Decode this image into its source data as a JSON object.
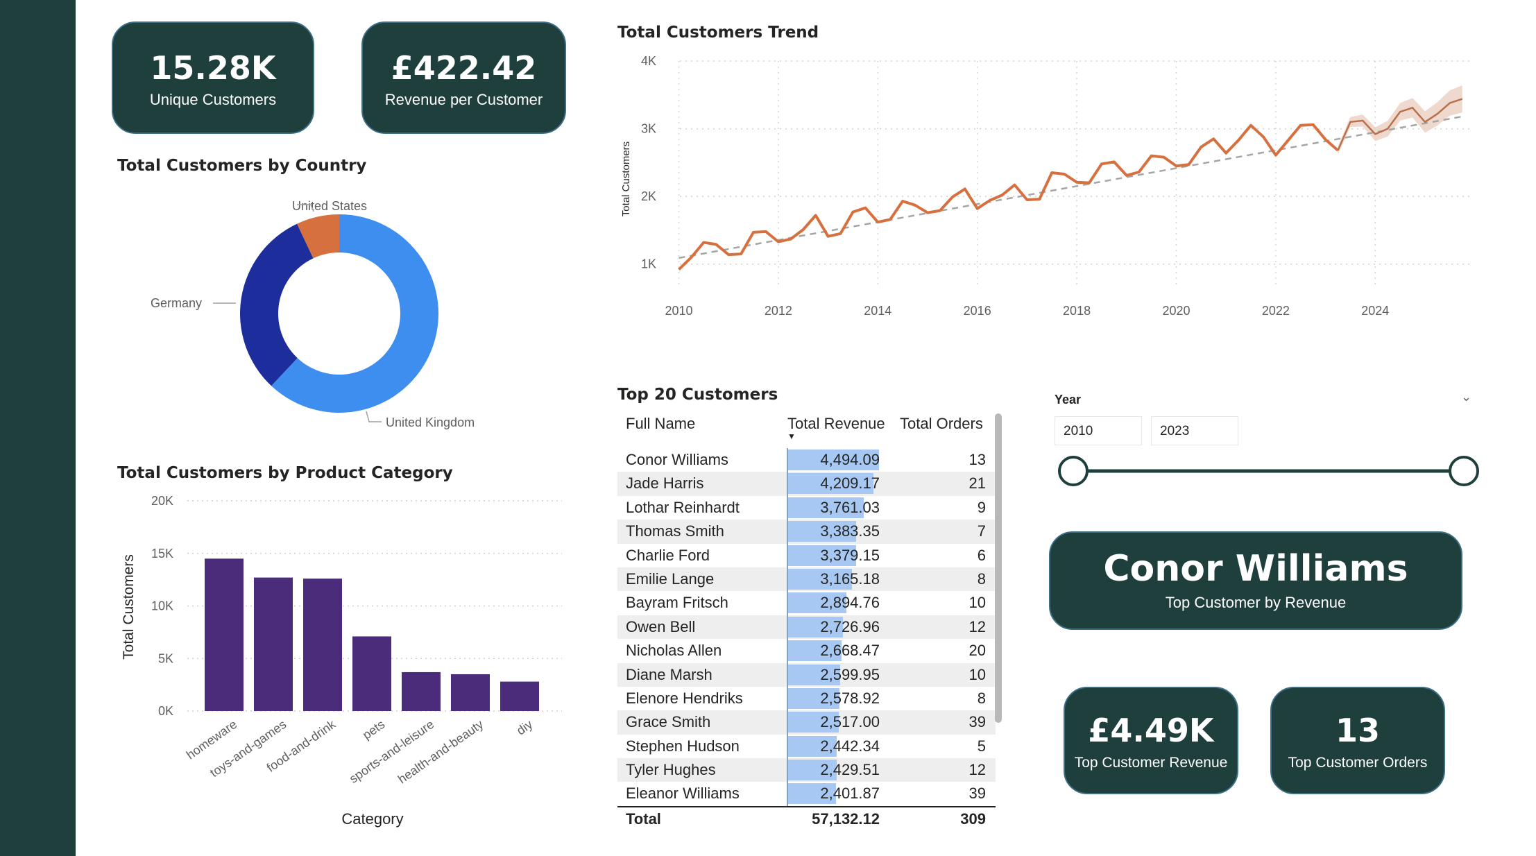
{
  "kpis": {
    "unique_customers": {
      "value": "15.28K",
      "label": "Unique Customers"
    },
    "revenue_per_customer": {
      "value": "£422.42",
      "label": "Revenue per Customer"
    },
    "top_customer": {
      "value": "Conor Williams",
      "label": "Top Customer by Revenue"
    },
    "top_customer_revenue": {
      "value": "£4.49K",
      "label": "Top Customer Revenue"
    },
    "top_customer_orders": {
      "value": "13",
      "label": "Top Customer Orders"
    }
  },
  "colors": {
    "sidebar": "#1f3f3c",
    "card": "#1f3f3c",
    "card_border": "#3c6e86",
    "trend_line": "#d6703f",
    "bar": "#4b2c7a",
    "donut_uk": "#3e8ef0",
    "donut_de": "#1d2e9c",
    "donut_us": "#d6703f",
    "revenue_bar": "#a6c8f2"
  },
  "chart_data": [
    {
      "type": "pie",
      "title": "Total Customers by Country",
      "labels": [
        "United Kingdom",
        "Germany",
        "United States"
      ],
      "values": [
        62,
        31,
        7
      ]
    },
    {
      "type": "bar",
      "title": "Total Customers by Product Category",
      "xlabel": "Category",
      "ylabel": "Total Customers",
      "categories": [
        "homeware",
        "toys-and-games",
        "food-and-drink",
        "pets",
        "sports-and-leisure",
        "health-and-beauty",
        "diy"
      ],
      "values": [
        14500,
        12700,
        12600,
        7100,
        3700,
        3500,
        2800
      ],
      "ylim": [
        0,
        20000
      ],
      "yticks": [
        "0K",
        "5K",
        "10K",
        "15K",
        "20K"
      ],
      "grid": true
    },
    {
      "type": "line",
      "title": "Total Customers Trend",
      "ylabel": "Total Customers",
      "ylim": [
        700,
        4000
      ],
      "xlim": [
        2010,
        2025.9
      ],
      "xticks": [
        "2010",
        "2012",
        "2014",
        "2016",
        "2018",
        "2020",
        "2022",
        "2024"
      ],
      "yticks": [
        "1K",
        "2K",
        "3K",
        "4K"
      ],
      "grid": true,
      "series": [
        {
          "x": [
            2010.0,
            2010.25,
            2010.5,
            2010.75,
            2011.0,
            2011.25,
            2011.5,
            2011.75,
            2012.0,
            2012.25,
            2012.5,
            2012.75,
            2013.0,
            2013.25,
            2013.5,
            2013.75,
            2014.0,
            2014.25,
            2014.5,
            2014.75,
            2015.0,
            2015.25,
            2015.5,
            2015.75,
            2016.0,
            2016.25,
            2016.5,
            2016.75,
            2017.0,
            2017.25,
            2017.5,
            2017.75,
            2018.0,
            2018.25,
            2018.5,
            2018.75,
            2019.0,
            2019.25,
            2019.5,
            2019.75,
            2020.0,
            2020.25,
            2020.5,
            2020.75,
            2021.0,
            2021.25,
            2021.5,
            2021.75,
            2022.0,
            2022.25,
            2022.5,
            2022.75,
            2023.0,
            2023.25
          ],
          "values": [
            920,
            1100,
            1320,
            1290,
            1140,
            1150,
            1470,
            1480,
            1330,
            1370,
            1510,
            1720,
            1410,
            1450,
            1770,
            1830,
            1620,
            1660,
            1930,
            1870,
            1760,
            1790,
            1990,
            2110,
            1820,
            1940,
            2020,
            2170,
            1950,
            1960,
            2350,
            2330,
            2210,
            2200,
            2480,
            2510,
            2310,
            2360,
            2600,
            2580,
            2450,
            2470,
            2730,
            2850,
            2640,
            2830,
            3050,
            2880,
            2610,
            2830,
            3050,
            3060,
            2840,
            2680
          ]
        },
        {
          "x": [
            2023.25,
            2023.5,
            2023.75,
            2024.0,
            2024.25,
            2024.5,
            2024.75,
            2025.0,
            2025.25,
            2025.5,
            2025.75
          ],
          "values": [
            2680,
            3100,
            3120,
            2920,
            3000,
            3250,
            3310,
            3100,
            3220,
            3380,
            3440
          ]
        },
        {
          "x": [
            2010.0,
            2025.75
          ],
          "values": [
            1090,
            3180
          ]
        }
      ]
    },
    {
      "type": "table",
      "title": "Top 20 Customers",
      "columns": [
        "Full Name",
        "Total Revenue",
        "Total Orders"
      ],
      "rows": [
        [
          "Conor Williams",
          "4,494.09",
          "13"
        ],
        [
          "Jade Harris",
          "4,209.17",
          "21"
        ],
        [
          "Lothar Reinhardt",
          "3,761.03",
          "9"
        ],
        [
          "Thomas Smith",
          "3,383.35",
          "7"
        ],
        [
          "Charlie Ford",
          "3,379.15",
          "6"
        ],
        [
          "Emilie Lange",
          "3,165.18",
          "8"
        ],
        [
          "Bayram Fritsch",
          "2,894.76",
          "10"
        ],
        [
          "Owen Bell",
          "2,726.96",
          "12"
        ],
        [
          "Nicholas Allen",
          "2,668.47",
          "20"
        ],
        [
          "Diane Marsh",
          "2,599.95",
          "10"
        ],
        [
          "Elenore Hendriks",
          "2,578.92",
          "8"
        ],
        [
          "Grace Smith",
          "2,517.00",
          "39"
        ],
        [
          "Stephen Hudson",
          "2,442.34",
          "5"
        ],
        [
          "Tyler Hughes",
          "2,429.51",
          "12"
        ],
        [
          "Eleanor Williams",
          "2,401.87",
          "39"
        ]
      ],
      "total": [
        "Total",
        "57,132.12",
        "309"
      ]
    }
  ],
  "year_slicer": {
    "label": "Year",
    "from": "2010",
    "to": "2023"
  }
}
